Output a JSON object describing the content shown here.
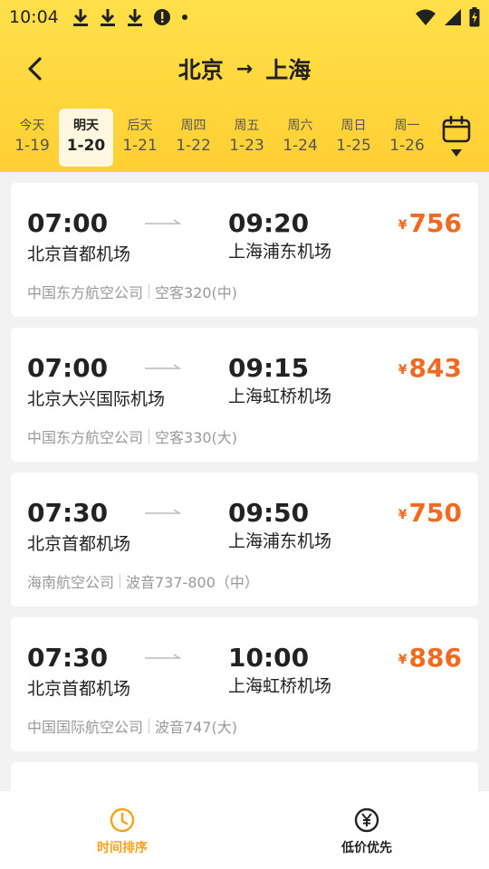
{
  "status_bar": {
    "time": "10:04",
    "left_icons": [
      "download-icon",
      "download-icon",
      "download-icon",
      "alert-icon",
      "dot-icon"
    ],
    "right_icons": [
      "wifi-icon",
      "signal-icon",
      "battery-icon"
    ]
  },
  "header": {
    "from": "北京",
    "arrow": "→",
    "to": "上海"
  },
  "dates": [
    {
      "day": "今天",
      "md": "1-19",
      "active": false
    },
    {
      "day": "明天",
      "md": "1-20",
      "active": true
    },
    {
      "day": "后天",
      "md": "1-21",
      "active": false
    },
    {
      "day": "周四",
      "md": "1-22",
      "active": false
    },
    {
      "day": "周五",
      "md": "1-23",
      "active": false
    },
    {
      "day": "周六",
      "md": "1-24",
      "active": false
    },
    {
      "day": "周日",
      "md": "1-25",
      "active": false
    },
    {
      "day": "周一",
      "md": "1-26",
      "active": false
    }
  ],
  "flights": [
    {
      "dep_time": "07:00",
      "arr_time": "09:20",
      "dep_airport": "北京首都机场",
      "arr_airport": "上海浦东机场",
      "price_symbol": "¥",
      "price": "756",
      "airline": "中国东方航空公司",
      "aircraft": "空客320(中)"
    },
    {
      "dep_time": "07:00",
      "arr_time": "09:15",
      "dep_airport": "北京大兴国际机场",
      "arr_airport": "上海虹桥机场",
      "price_symbol": "¥",
      "price": "843",
      "airline": "中国东方航空公司",
      "aircraft": "空客330(大)"
    },
    {
      "dep_time": "07:30",
      "arr_time": "09:50",
      "dep_airport": "北京首都机场",
      "arr_airport": "上海浦东机场",
      "price_symbol": "¥",
      "price": "750",
      "airline": "海南航空公司",
      "aircraft": "波音737-800（中）"
    },
    {
      "dep_time": "07:30",
      "arr_time": "10:00",
      "dep_airport": "北京首都机场",
      "arr_airport": "上海虹桥机场",
      "price_symbol": "¥",
      "price": "886",
      "airline": "中国国际航空公司",
      "aircraft": "波音747(大)"
    }
  ],
  "bottom_bar": {
    "time_sort": "时间排序",
    "price_sort": "低价优先"
  },
  "colors": {
    "header_yellow": "#ffd63d",
    "price_orange": "#f26a21",
    "active_tab": "#f7a21b"
  }
}
